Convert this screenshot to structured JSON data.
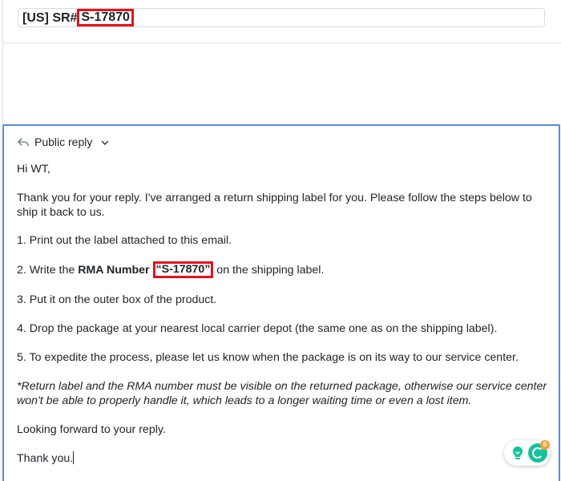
{
  "ticket": {
    "subject_prefix": "[US] SR#",
    "subject_number": "S-17870"
  },
  "composer": {
    "reply_type": "Public reply",
    "greeting": "Hi WT,",
    "intro": "Thank you for your reply. I've arranged a return shipping label for you. Please follow the steps below to ship it back to us.",
    "step1": "1. Print out the label attached to this email.",
    "step2_before": "2. Write the ",
    "step2_bold": "RMA Number",
    "step2_rma": "“S-17870”",
    "step2_after": " on the shipping label.",
    "step3": "3. Put it on the outer box of the product.",
    "step4": "4. Drop the package at your nearest local carrier depot (the same one as on the shipping label).",
    "step5": "5. To expedite the process, please let us know when the package is on its way to our service center.",
    "note": "*Return label and the RMA number must be visible on the returned package, otherwise our service center won't be able to properly handle it, which leads to a longer waiting time or even a lost item.",
    "closing": "Looking forward to your reply.",
    "signoff": "Thank you."
  },
  "assistant": {
    "badge_count": "6",
    "bulb_icon": "lightbulb-icon",
    "grammar_icon": "grammar-assistant-icon",
    "accent": "#15c39a"
  },
  "colors": {
    "highlight": "#e3121d",
    "focus_border": "#5b8bd6"
  }
}
